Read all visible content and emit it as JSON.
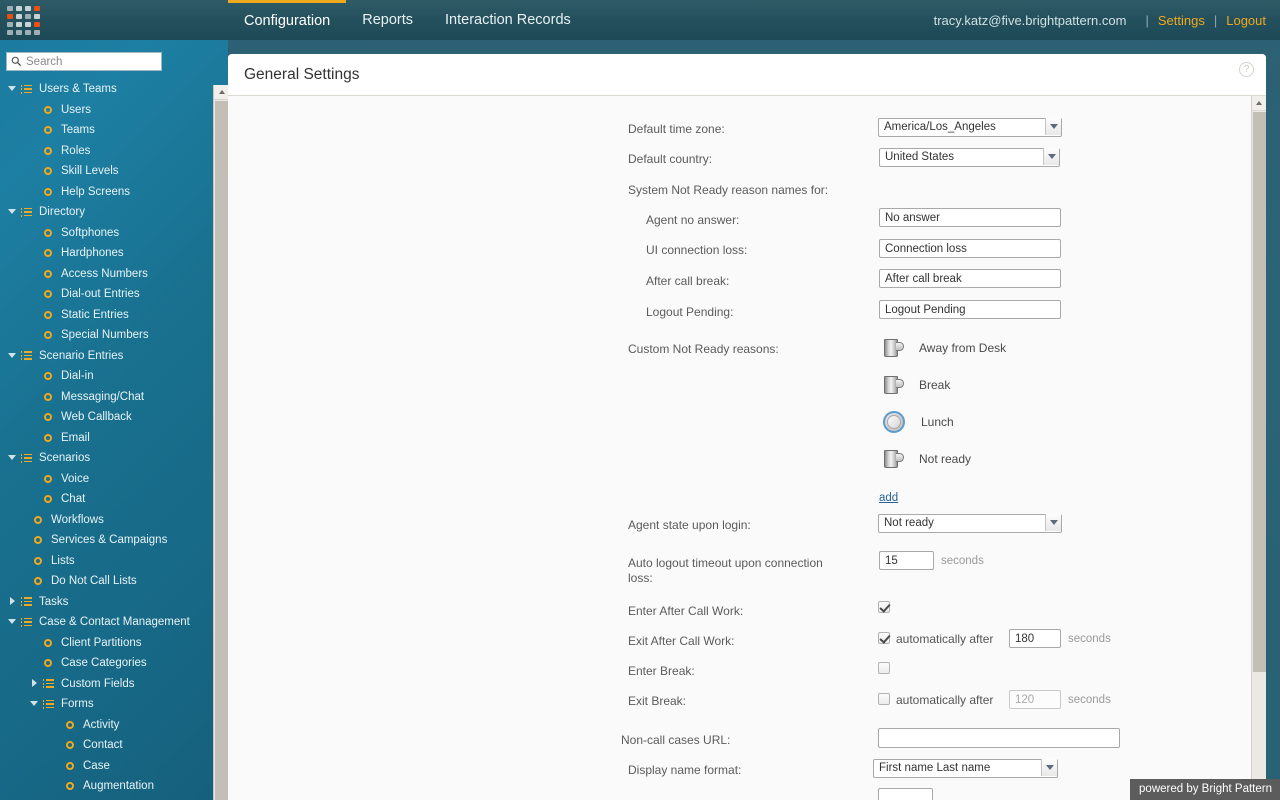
{
  "topbar": {
    "logo_name": "bright-pattern-logo",
    "nav": [
      {
        "label": "Configuration",
        "active": true
      },
      {
        "label": "Reports",
        "active": false
      },
      {
        "label": "Interaction Records",
        "active": false
      }
    ],
    "account_email": "tracy.katz@five.brightpattern.com",
    "separator": "|",
    "settings_label": "Settings",
    "logout_label": "Logout"
  },
  "sidebar": {
    "search_placeholder": "Search",
    "search_value": "",
    "tree": [
      {
        "label": "Users & Teams",
        "level": 0,
        "icon": "list-icon",
        "arrow": "expanded"
      },
      {
        "label": "Users",
        "level": 1,
        "icon": "ring-icon",
        "arrow": ""
      },
      {
        "label": "Teams",
        "level": 1,
        "icon": "ring-icon",
        "arrow": ""
      },
      {
        "label": "Roles",
        "level": 1,
        "icon": "ring-icon",
        "arrow": ""
      },
      {
        "label": "Skill Levels",
        "level": 1,
        "icon": "ring-icon",
        "arrow": ""
      },
      {
        "label": "Help Screens",
        "level": 1,
        "icon": "ring-icon",
        "arrow": ""
      },
      {
        "label": "Directory",
        "level": 0,
        "icon": "list-icon",
        "arrow": "expanded"
      },
      {
        "label": "Softphones",
        "level": 1,
        "icon": "ring-icon",
        "arrow": ""
      },
      {
        "label": "Hardphones",
        "level": 1,
        "icon": "ring-icon",
        "arrow": ""
      },
      {
        "label": "Access Numbers",
        "level": 1,
        "icon": "ring-icon",
        "arrow": ""
      },
      {
        "label": "Dial-out Entries",
        "level": 1,
        "icon": "ring-icon",
        "arrow": ""
      },
      {
        "label": "Static Entries",
        "level": 1,
        "icon": "ring-icon",
        "arrow": ""
      },
      {
        "label": "Special Numbers",
        "level": 1,
        "icon": "ring-icon",
        "arrow": ""
      },
      {
        "label": "Scenario Entries",
        "level": 0,
        "icon": "list-icon",
        "arrow": "expanded"
      },
      {
        "label": "Dial-in",
        "level": 1,
        "icon": "ring-icon",
        "arrow": ""
      },
      {
        "label": "Messaging/Chat",
        "level": 1,
        "icon": "ring-icon",
        "arrow": ""
      },
      {
        "label": "Web Callback",
        "level": 1,
        "icon": "ring-icon",
        "arrow": ""
      },
      {
        "label": "Email",
        "level": 1,
        "icon": "ring-icon",
        "arrow": ""
      },
      {
        "label": "Scenarios",
        "level": 0,
        "icon": "list-icon",
        "arrow": "expanded"
      },
      {
        "label": "Voice",
        "level": 1,
        "icon": "ring-icon",
        "arrow": ""
      },
      {
        "label": "Chat",
        "level": 1,
        "icon": "ring-icon",
        "arrow": ""
      },
      {
        "label": "Workflows",
        "level": 0,
        "icon": "ring-icon",
        "arrow": "",
        "offset": 1
      },
      {
        "label": "Services & Campaigns",
        "level": 0,
        "icon": "ring-icon",
        "arrow": "",
        "offset": 1
      },
      {
        "label": "Lists",
        "level": 0,
        "icon": "ring-icon",
        "arrow": "",
        "offset": 1
      },
      {
        "label": "Do Not Call Lists",
        "level": 0,
        "icon": "ring-icon",
        "arrow": "",
        "offset": 1
      },
      {
        "label": "Tasks",
        "level": 0,
        "icon": "list-icon",
        "arrow": "collapsed"
      },
      {
        "label": "Case & Contact Management",
        "level": 0,
        "icon": "list-icon",
        "arrow": "expanded"
      },
      {
        "label": "Client Partitions",
        "level": 1,
        "icon": "ring-icon",
        "arrow": ""
      },
      {
        "label": "Case Categories",
        "level": 1,
        "icon": "ring-icon",
        "arrow": ""
      },
      {
        "label": "Custom Fields",
        "level": 1,
        "icon": "list-icon",
        "arrow": "collapsed"
      },
      {
        "label": "Forms",
        "level": 1,
        "icon": "list-icon",
        "arrow": "expanded"
      },
      {
        "label": "Activity",
        "level": 2,
        "icon": "ring-icon",
        "arrow": ""
      },
      {
        "label": "Contact",
        "level": 2,
        "icon": "ring-icon",
        "arrow": ""
      },
      {
        "label": "Case",
        "level": 2,
        "icon": "ring-icon",
        "arrow": ""
      },
      {
        "label": "Augmentation",
        "level": 2,
        "icon": "ring-icon",
        "arrow": ""
      }
    ]
  },
  "panel": {
    "title": "General Settings",
    "help_icon": "question-mark-icon"
  },
  "form": {
    "default_time_zone": {
      "label": "Default time zone:",
      "value": "America/Los_Angeles"
    },
    "default_country": {
      "label": "Default country:",
      "value": "United States"
    },
    "system_not_ready_heading": "System Not Ready reason names for:",
    "agent_no_answer": {
      "label": "Agent no answer:",
      "value": "No answer"
    },
    "ui_connection_loss": {
      "label": "UI connection loss:",
      "value": "Connection loss"
    },
    "after_call_break": {
      "label": "After call break:",
      "value": "After call break"
    },
    "logout_pending": {
      "label": "Logout Pending:",
      "value": "Logout Pending"
    },
    "custom_not_ready": {
      "label": "Custom Not Ready reasons:",
      "items": [
        {
          "label": "Away from Desk",
          "icon": "coffee-mug-icon"
        },
        {
          "label": "Break",
          "icon": "coffee-mug-icon"
        },
        {
          "label": "Lunch",
          "icon": "plate-icon"
        },
        {
          "label": "Not ready",
          "icon": "coffee-mug-icon"
        }
      ],
      "add_label": "add"
    },
    "agent_state_upon_login": {
      "label": "Agent state upon login:",
      "value": "Not ready"
    },
    "auto_logout_timeout": {
      "label": "Auto logout timeout upon connection loss:",
      "value": "15",
      "unit": "seconds"
    },
    "enter_after_call_work": {
      "label": "Enter After Call Work:",
      "checked": true
    },
    "exit_after_call_work": {
      "label": "Exit After Call Work:",
      "checked": true,
      "inline_label": "automatically after",
      "value": "180",
      "unit": "seconds"
    },
    "enter_break": {
      "label": "Enter Break:",
      "checked": false
    },
    "exit_break": {
      "label": "Exit Break:",
      "checked": false,
      "inline_label": "automatically after",
      "value": "120",
      "unit": "seconds"
    },
    "non_call_cases_url": {
      "label": "Non-call cases URL:",
      "value": ""
    },
    "display_name_format": {
      "label": "Display name format:",
      "value": "First name  Last name"
    }
  },
  "watermark": "powered by Bright Pattern"
}
